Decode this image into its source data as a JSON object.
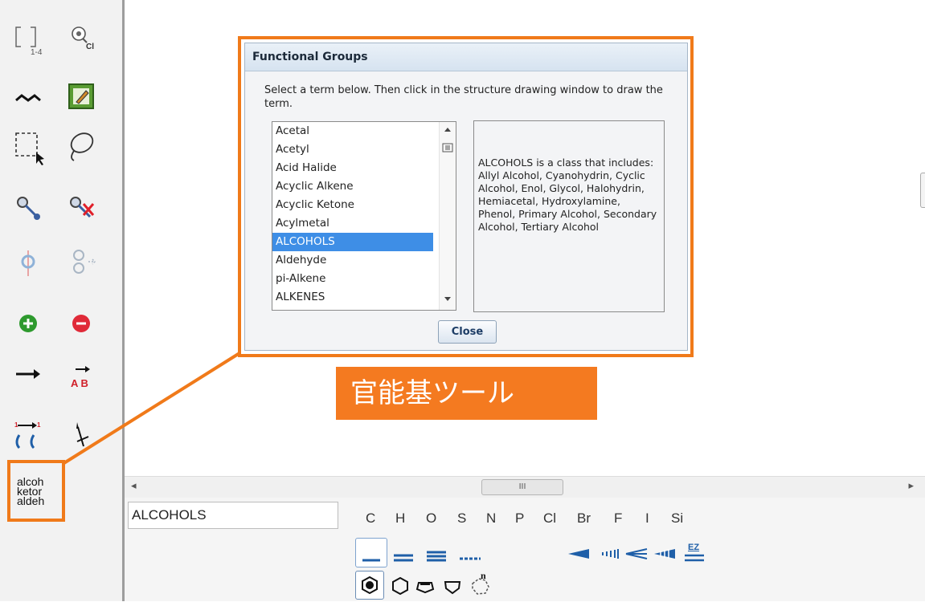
{
  "dialog": {
    "title": "Functional Groups",
    "instructions": "Select a term below. Then click in the structure drawing window to draw the term.",
    "terms": [
      "Acetal",
      "Acetyl",
      "Acid Halide",
      "Acyclic Alkene",
      "Acyclic Ketone",
      "Acylmetal",
      "ALCOHOLS",
      "Aldehyde",
      "pi-Alkene",
      "ALKENES"
    ],
    "selected_term": "ALCOHOLS",
    "description": "ALCOHOLS is a class that includes: Allyl Alcohol, Cyanohydrin, Cyclic Alcohol, Enol, Glycol, Halohydrin, Hemiacetal, Hydroxylamine, Phenol, Primary Alcohol, Secondary Alcohol, Tertiary Alcohol",
    "close_label": "Close"
  },
  "callout": {
    "label": "官能基ツール",
    "color": "#f47a20"
  },
  "palette": {
    "template_label": "1-4",
    "query_label": "Cl",
    "arrow_ab_label": "A B",
    "groups_tool_lines": [
      "alcoh",
      "ketor",
      "aldeh"
    ]
  },
  "formula": {
    "value": "ALCOHOLS"
  },
  "elements": [
    "C",
    "H",
    "O",
    "S",
    "N",
    "P",
    "Cl",
    "Br",
    "F",
    "I",
    "Si"
  ],
  "stereo_label": "EZ",
  "ring_size_label": "n",
  "hscroll": {
    "thumb_grip": "III",
    "left_arrow": "◂",
    "right_arrow": "▸"
  },
  "colors": {
    "accent": "#f07a1a",
    "selection": "#3e8ee6",
    "bond_blue": "#1f5fa8"
  }
}
